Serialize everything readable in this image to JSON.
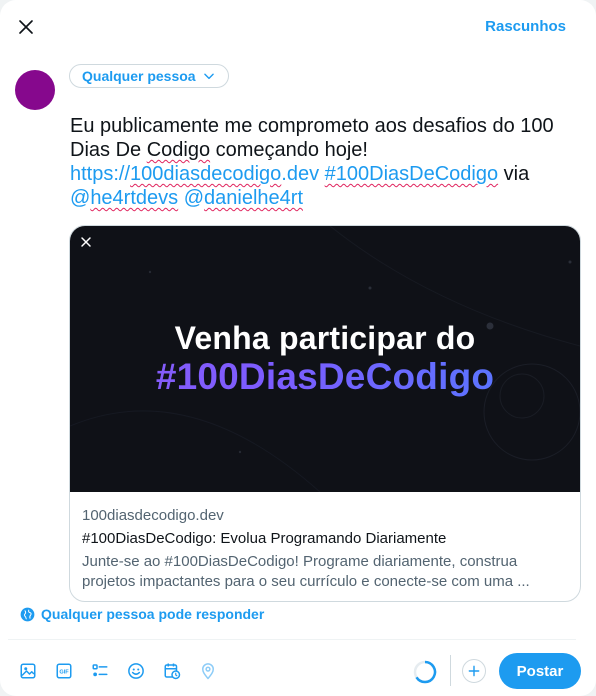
{
  "header": {
    "close_icon": "close-icon",
    "drafts_label": "Rascunhos"
  },
  "composer": {
    "audience_label": "Qualquer pessoa",
    "audience_icon": "chevron-down-icon",
    "avatar_color": "#86088d",
    "text_line1": "Eu publicamente me comprometo aos desafios do 100",
    "text_line2_a": "Dias De ",
    "text_line2_b": "Codigo",
    "text_line2_c": " começando hoje!",
    "link_url": "https://100diasdecodigo.dev",
    "hashtag": "#100DiasDeCodigo",
    "via_text": " via",
    "mention1": "@he4rtdevs",
    "mention2": "@danielhe4rt"
  },
  "card": {
    "banner_line1": "Venha participar do",
    "banner_line2": "#100DiasDeCodigo",
    "domain": "100diasdecodigo.dev",
    "title": "#100DiasDeCodigo: Evolua Programando Diariamente",
    "description_line1": "Junte-se ao #100DiasDeCodigo! Programe diariamente, construa",
    "description_line2": "projetos impactantes para o seu currículo e conecte-se com uma ..."
  },
  "reply_permission": {
    "icon": "globe-icon",
    "label": "Qualquer pessoa pode responder"
  },
  "toolbar": {
    "tools": [
      "image-icon",
      "gif-icon",
      "poll-icon",
      "emoji-icon",
      "schedule-icon",
      "location-icon"
    ],
    "post_label": "Postar"
  },
  "colors": {
    "accent": "#1d9bf0",
    "text": "#0f1419",
    "muted": "#536471"
  }
}
